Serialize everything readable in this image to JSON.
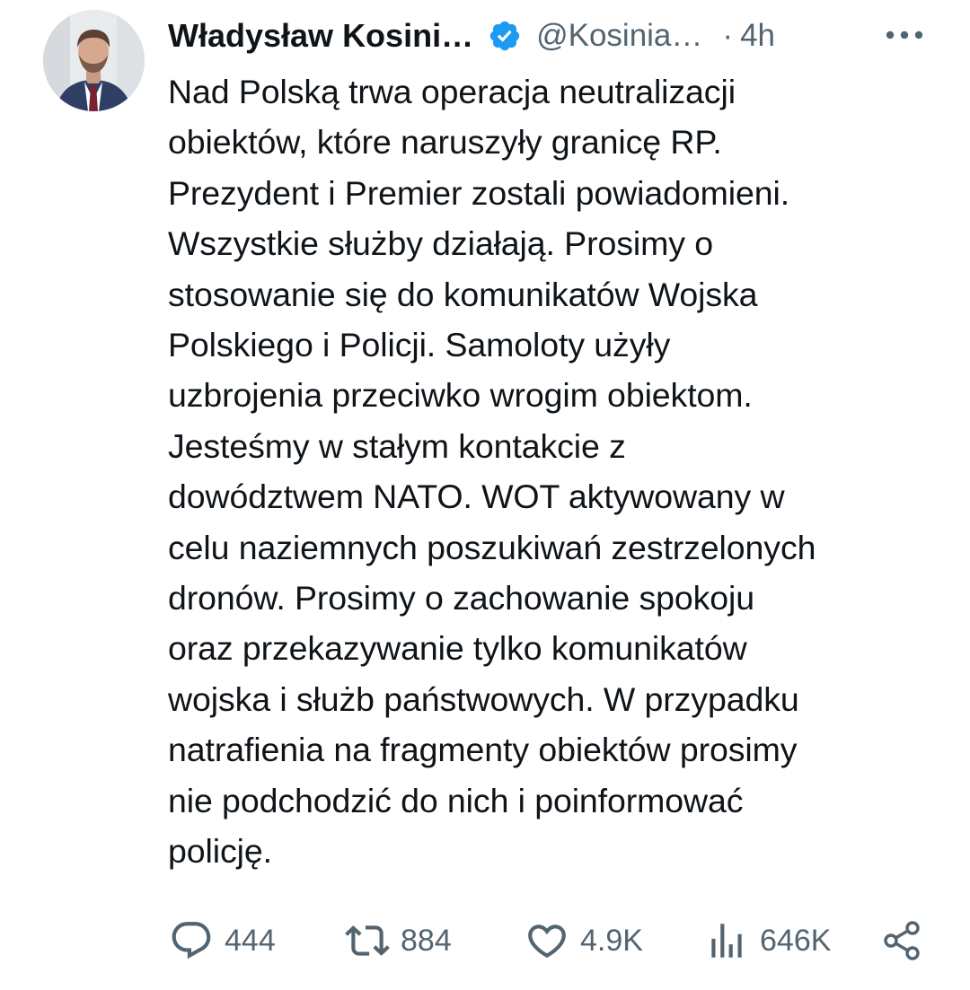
{
  "tweet": {
    "author": {
      "display_name": "Władysław Kosini…",
      "handle": "@Kosinia…",
      "verified": true
    },
    "separator": "·",
    "time": "4h",
    "text": "Nad Polską trwa operacja neutralizacji\nobiektów, które naruszyły granicę RP.\nPrezydent i Premier zostali powiadomieni.\nWszystkie służby działają. Prosimy o\nstosowanie się do komunikatów Wojska\nPolskiego i Policji. Samoloty użyły\nuzbrojenia przeciwko wrogim obiektom.\nJesteśmy w stałym kontakcie z\ndowództwem NATO. WOT aktywowany w\ncelu naziemnych poszukiwań zestrzelonych\ndronów. Prosimy o zachowanie spokoju\noraz przekazywanie tylko komunikatów\nwojska i służb państwowych. W przypadku\nnatrafienia na fragmenty obiektów prosimy\nnie podchodzić do nich i poinformować\npolicję.",
    "stats": {
      "replies": "444",
      "reposts": "884",
      "likes": "4.9K",
      "views": "646K"
    }
  },
  "icons": {
    "verified": "verified-badge-icon",
    "more": "more-icon",
    "reply": "reply-icon",
    "repost": "repost-icon",
    "like": "heart-icon",
    "views": "views-chart-icon",
    "share": "share-icon"
  },
  "colors": {
    "text_primary": "#0f1419",
    "text_secondary": "#536471",
    "verified_blue": "#1d9bf0",
    "background": "#ffffff"
  }
}
